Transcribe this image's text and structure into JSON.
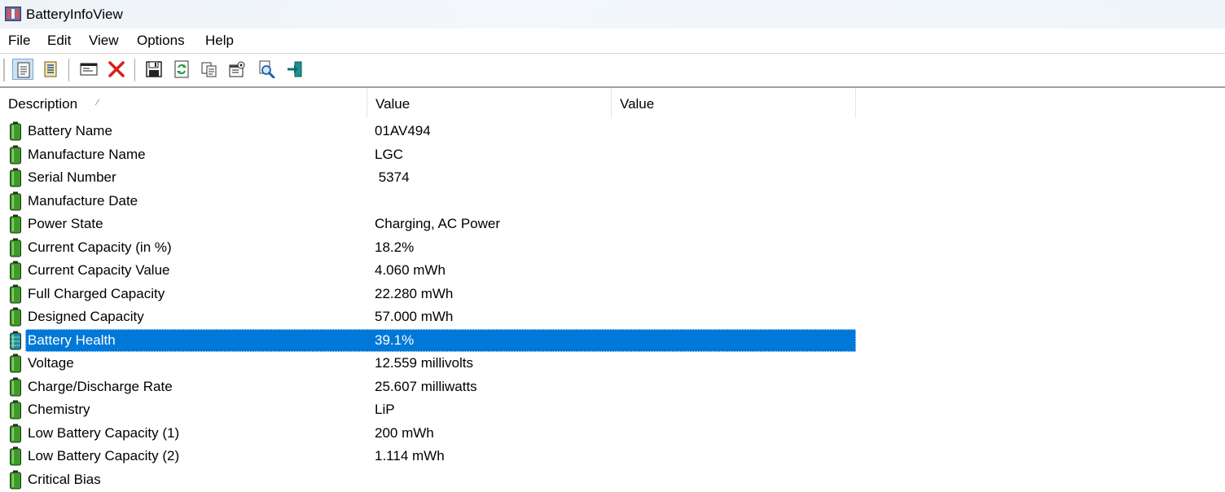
{
  "window": {
    "title": "BatteryInfoView"
  },
  "menu": [
    "File",
    "Edit",
    "View",
    "Options",
    "Help"
  ],
  "toolbar": [
    {
      "name": "tb-report-view-button",
      "icon": "report-view-icon",
      "pressed": true
    },
    {
      "name": "tb-list-view-button",
      "icon": "list-view-icon",
      "pressed": false
    },
    {
      "sep": true
    },
    {
      "name": "tb-properties-window-button",
      "icon": "window-icon",
      "pressed": false
    },
    {
      "name": "tb-delete-button",
      "icon": "red-x-icon",
      "pressed": false
    },
    {
      "sep": true
    },
    {
      "name": "tb-save-button",
      "icon": "floppy-disk-icon",
      "pressed": false
    },
    {
      "name": "tb-refresh-button",
      "icon": "refresh-icon",
      "pressed": false
    },
    {
      "name": "tb-copy-button",
      "icon": "copy-icon",
      "pressed": false
    },
    {
      "name": "tb-properties-button",
      "icon": "properties-icon",
      "pressed": false
    },
    {
      "name": "tb-find-button",
      "icon": "find-icon",
      "pressed": false
    },
    {
      "name": "tb-exit-button",
      "icon": "exit-icon",
      "pressed": false
    }
  ],
  "columns": [
    "Description",
    "Value",
    "Value"
  ],
  "rows": [
    {
      "desc": "Battery Name",
      "value": "01AV494",
      "value2": ""
    },
    {
      "desc": "Manufacture Name",
      "value": "LGC",
      "value2": ""
    },
    {
      "desc": "Serial Number",
      "value": " 5374",
      "value2": ""
    },
    {
      "desc": "Manufacture Date",
      "value": "",
      "value2": ""
    },
    {
      "desc": "Power State",
      "value": "Charging, AC Power",
      "value2": ""
    },
    {
      "desc": "Current Capacity (in %)",
      "value": "18.2%",
      "value2": ""
    },
    {
      "desc": "Current Capacity Value",
      "value": "4.060 mWh",
      "value2": ""
    },
    {
      "desc": "Full Charged Capacity",
      "value": "22.280 mWh",
      "value2": ""
    },
    {
      "desc": "Designed Capacity",
      "value": "57.000 mWh",
      "value2": ""
    },
    {
      "desc": "Battery Health",
      "value": "39.1%",
      "value2": "",
      "selected": true
    },
    {
      "desc": "Voltage",
      "value": "12.559 millivolts",
      "value2": ""
    },
    {
      "desc": "Charge/Discharge Rate",
      "value": "25.607 milliwatts",
      "value2": ""
    },
    {
      "desc": "Chemistry",
      "value": "LiP",
      "value2": ""
    },
    {
      "desc": "Low Battery Capacity (1)",
      "value": "200 mWh",
      "value2": ""
    },
    {
      "desc": "Low Battery Capacity (2)",
      "value": "1.114 mWh",
      "value2": ""
    },
    {
      "desc": "Critical Bias",
      "value": "",
      "value2": ""
    }
  ],
  "colors": {
    "selection": "#0078d7",
    "battery_green": "#3f9a2a",
    "battery_selected": "#1e8fa0"
  }
}
